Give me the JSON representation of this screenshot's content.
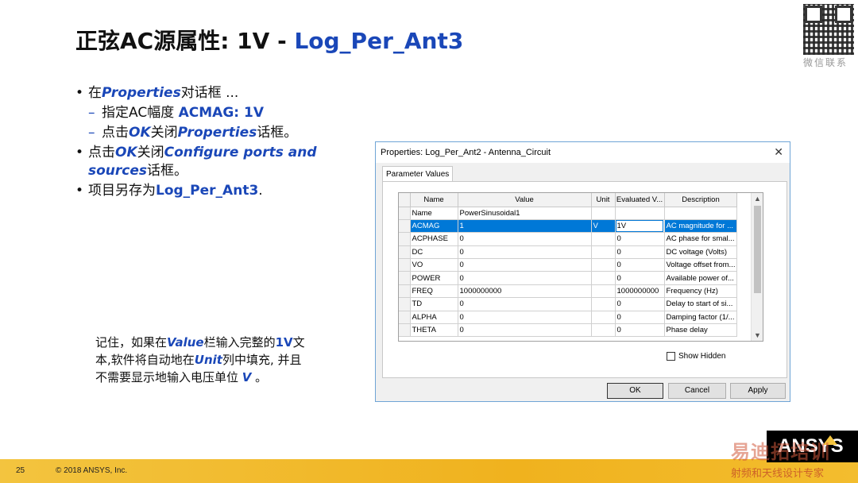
{
  "slide": {
    "title_main": "正弦AC源属性: 1V - ",
    "title_blue": "Log_Per_Ant3",
    "qr_caption": "微信联系"
  },
  "bullets": {
    "b1_prefix": "在",
    "b1_em": "Properties",
    "b1_suffix": "对话框 ...",
    "s1_prefix": "指定AC幅度 ",
    "s1_em": "ACMAG:  1V",
    "s2_prefix": "点击",
    "s2_em1": "OK",
    "s2_mid": "关闭",
    "s2_em2": "Properties",
    "s2_suffix": "话框。",
    "b2_prefix": "点击",
    "b2_em1": "OK",
    "b2_mid": "关闭",
    "b2_em2": "Configure ports and sources",
    "b2_suffix": "话框。",
    "b3_prefix": "项目另存为",
    "b3_em": "Log_Per_Ant3",
    "b3_suffix": "."
  },
  "note": {
    "p1": "记住，如果在",
    "em1": "Value",
    "p2": "栏输入完整的",
    "em2": "1V",
    "p3": "文本,软件将自动地在",
    "em3": "Unit",
    "p4": "列中填充, 并且不需要显示地输入电压单位 ",
    "em4": "V",
    "p5": " 。"
  },
  "dialog": {
    "title": "Properties: Log_Per_Ant2 - Antenna_Circuit",
    "close": "✕",
    "tab": "Parameter Values",
    "columns": [
      "Name",
      "Value",
      "Unit",
      "Evaluated V...",
      "Description"
    ],
    "rows": [
      {
        "name": "Name",
        "value": "PowerSinusoidal1",
        "unit": "",
        "evaluated": "",
        "description": ""
      },
      {
        "name": "ACMAG",
        "value": "1",
        "unit": "V",
        "evaluated": "1V",
        "description": "AC magnitude for ..."
      },
      {
        "name": "ACPHASE",
        "value": "0",
        "unit": "",
        "evaluated": "0",
        "description": "AC phase for smal..."
      },
      {
        "name": "DC",
        "value": "0",
        "unit": "",
        "evaluated": "0",
        "description": "DC voltage (Volts)"
      },
      {
        "name": "VO",
        "value": "0",
        "unit": "",
        "evaluated": "0",
        "description": "Voltage offset from..."
      },
      {
        "name": "POWER",
        "value": "0",
        "unit": "",
        "evaluated": "0",
        "description": "Available power of..."
      },
      {
        "name": "FREQ",
        "value": "1000000000",
        "unit": "",
        "evaluated": "1000000000",
        "description": "Frequency (Hz)"
      },
      {
        "name": "TD",
        "value": "0",
        "unit": "",
        "evaluated": "0",
        "description": "Delay to start of si..."
      },
      {
        "name": "ALPHA",
        "value": "0",
        "unit": "",
        "evaluated": "0",
        "description": "Damping factor (1/..."
      },
      {
        "name": "THETA",
        "value": "0",
        "unit": "",
        "evaluated": "0",
        "description": "Phase delay"
      }
    ],
    "show_hidden": "Show Hidden",
    "ok": "OK",
    "cancel": "Cancel",
    "apply": "Apply"
  },
  "footer": {
    "page": "25",
    "copyright": "© 2018 ANSYS, Inc.",
    "logo": "ANSYS",
    "watermark_1": "易迪拓培训",
    "watermark_2": "射频和天线设计专家"
  }
}
